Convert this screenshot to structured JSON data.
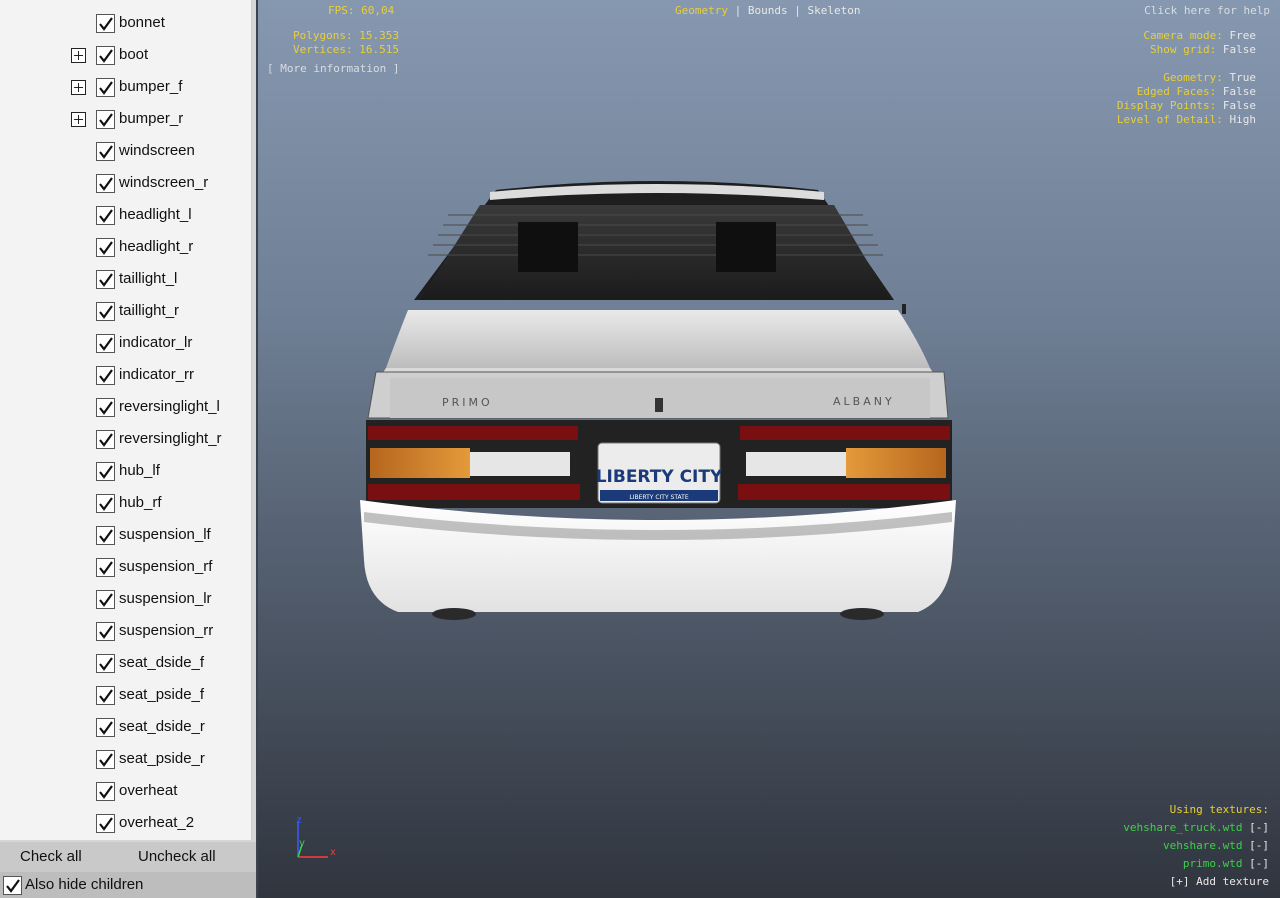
{
  "tree": {
    "items": [
      {
        "label": "bonnet",
        "expandable": false
      },
      {
        "label": "boot",
        "expandable": true
      },
      {
        "label": "bumper_f",
        "expandable": true
      },
      {
        "label": "bumper_r",
        "expandable": true
      },
      {
        "label": "windscreen",
        "expandable": false
      },
      {
        "label": "windscreen_r",
        "expandable": false
      },
      {
        "label": "headlight_l",
        "expandable": false
      },
      {
        "label": "headlight_r",
        "expandable": false
      },
      {
        "label": "taillight_l",
        "expandable": false
      },
      {
        "label": "taillight_r",
        "expandable": false
      },
      {
        "label": "indicator_lr",
        "expandable": false
      },
      {
        "label": "indicator_rr",
        "expandable": false
      },
      {
        "label": "reversinglight_l",
        "expandable": false
      },
      {
        "label": "reversinglight_r",
        "expandable": false
      },
      {
        "label": "hub_lf",
        "expandable": false
      },
      {
        "label": "hub_rf",
        "expandable": false
      },
      {
        "label": "suspension_lf",
        "expandable": false
      },
      {
        "label": "suspension_rf",
        "expandable": false
      },
      {
        "label": "suspension_lr",
        "expandable": false
      },
      {
        "label": "suspension_rr",
        "expandable": false
      },
      {
        "label": "seat_dside_f",
        "expandable": false
      },
      {
        "label": "seat_pside_f",
        "expandable": false
      },
      {
        "label": "seat_dside_r",
        "expandable": false
      },
      {
        "label": "seat_pside_r",
        "expandable": false
      },
      {
        "label": "overheat",
        "expandable": false
      },
      {
        "label": "overheat_2",
        "expandable": false
      }
    ]
  },
  "buttons": {
    "check_all": "Check all",
    "uncheck_all": "Uncheck all"
  },
  "hide_children": {
    "label": "Also hide children",
    "checked": true
  },
  "stats": {
    "fps": "FPS: 60,04",
    "polygons": "Polygons: 15.353",
    "vertices": "Vertices: 16.515",
    "more_info": "[ More information ]"
  },
  "modes": {
    "geometry": "Geometry",
    "sep1": "|",
    "bounds": "Bounds",
    "sep2": "|",
    "skeleton": "Skeleton"
  },
  "help": "Click here for help",
  "settings": [
    {
      "key": "Camera mode:",
      "value": "Free"
    },
    {
      "key": "Show grid:",
      "value": "False"
    },
    {
      "key": "Geometry:",
      "value": "True"
    },
    {
      "key": "Edged Faces:",
      "value": "False"
    },
    {
      "key": "Display Points:",
      "value": "False"
    },
    {
      "key": "Level of Detail:",
      "value": "High"
    }
  ],
  "textures": {
    "heading": "Using textures:",
    "files": [
      {
        "name": "vehshare_truck.wtd",
        "action": "[-]"
      },
      {
        "name": "vehshare.wtd",
        "action": "[-]"
      },
      {
        "name": "primo.wtd",
        "action": "[-]"
      }
    ],
    "add": "[+] Add texture"
  },
  "axes": {
    "z": "z",
    "y": "y",
    "x": "x"
  },
  "car": {
    "badge_left": "PRIMO",
    "badge_right": "ALBANY",
    "plate_text": "LIBERTY CITY",
    "plate_sub": "LIBERTY CITY STATE"
  },
  "colors": {
    "accent_yellow": "#e8cf3a",
    "texture_green": "#3ed04a"
  }
}
